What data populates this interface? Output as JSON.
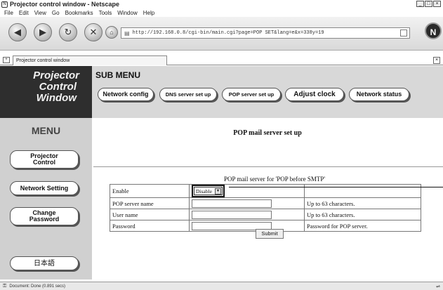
{
  "window": {
    "title": "Projector control window - Netscape",
    "controls": [
      "_",
      "□",
      "×"
    ]
  },
  "menubar": [
    "File",
    "Edit",
    "View",
    "Go",
    "Bookmarks",
    "Tools",
    "Window",
    "Help"
  ],
  "navbar": {
    "url": "http://192.168.0.8/cgi-bin/main.cgi?page=POP SET&lang=e&x=338y=19",
    "icons": [
      "back-icon",
      "forward-icon",
      "reload-icon",
      "stop-icon",
      "home-icon"
    ]
  },
  "tabs": [
    {
      "label": "Projector control window"
    }
  ],
  "brand": {
    "lines": [
      "Projector",
      "Control",
      "Window"
    ]
  },
  "submenu": {
    "title": "SUB MENU",
    "buttons": [
      "Network config",
      "DNS server set up",
      "POP server set up",
      "Adjust clock",
      "Network status"
    ]
  },
  "sidebar": {
    "title": "MENU",
    "buttons": [
      "Projector Control",
      "Network Setting",
      "Change Password",
      "日本語"
    ]
  },
  "main": {
    "title": "POP mail server set up",
    "caption": "POP mail server for 'POP before SMTP'",
    "rows": [
      {
        "label": "Enable",
        "select": "Disable",
        "note": ""
      },
      {
        "label": "POP server name",
        "value": "",
        "note": "Up to 63 characters."
      },
      {
        "label": "User name",
        "value": "",
        "note": "Up to 63 characters."
      },
      {
        "label": "Password",
        "value": "",
        "note": "Password for POP server."
      }
    ],
    "submit_label": "Submit"
  },
  "statusbar": {
    "text": "Document: Done (0.891 secs)"
  },
  "colors": {
    "brand_bg": "#2e2e2e",
    "submenu_bg": "#d8d8d8",
    "sidebar_bg": "#d0d0d0"
  }
}
